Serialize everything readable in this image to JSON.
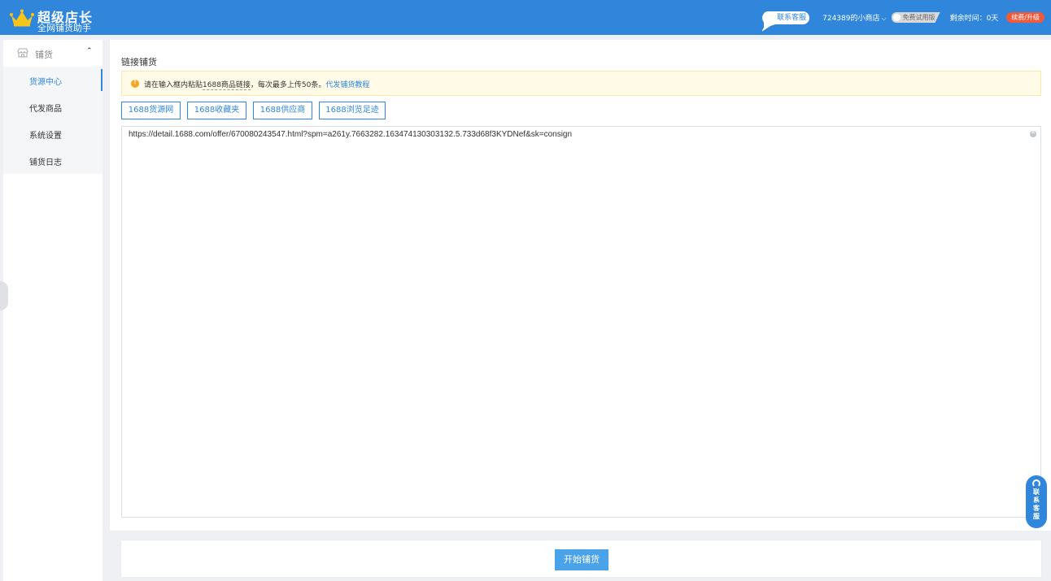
{
  "header": {
    "app_title": "超级店长",
    "app_subtitle": "全网铺货助手",
    "service_label": "联系客服",
    "shop_name": "724389的小商店",
    "trial_label": "免费试用版",
    "remaining_label": "剩余时间：0天",
    "renew_label": "续费/升级",
    "colors": {
      "bar": "#2f86db",
      "renew": "#f05a3b",
      "crown": "#f5c518"
    }
  },
  "sidebar": {
    "group_label": "铺货",
    "items": [
      {
        "label": "货源中心",
        "active": true
      },
      {
        "label": "代发商品",
        "active": false
      },
      {
        "label": "系统设置",
        "active": false
      },
      {
        "label": "铺货日志",
        "active": false
      }
    ]
  },
  "main": {
    "title": "链接铺货",
    "notice": {
      "text_before": "请在输入框内粘贴",
      "text_underlined": "1688商品链接",
      "text_after": "，每次最多上传50条。",
      "link_label": "代发铺货教程"
    },
    "source_buttons": [
      "1688货源网",
      "1688收藏夹",
      "1688供应商",
      "1688浏览足迹"
    ],
    "link_input_value": "https://detail.1688.com/offer/670080243547.html?spm=a261y.7663282.163474130303132.5.733d68f3KYDNef&sk=consign"
  },
  "footer": {
    "start_button_label": "开始铺货"
  },
  "float_service": {
    "label": "联系客服"
  }
}
